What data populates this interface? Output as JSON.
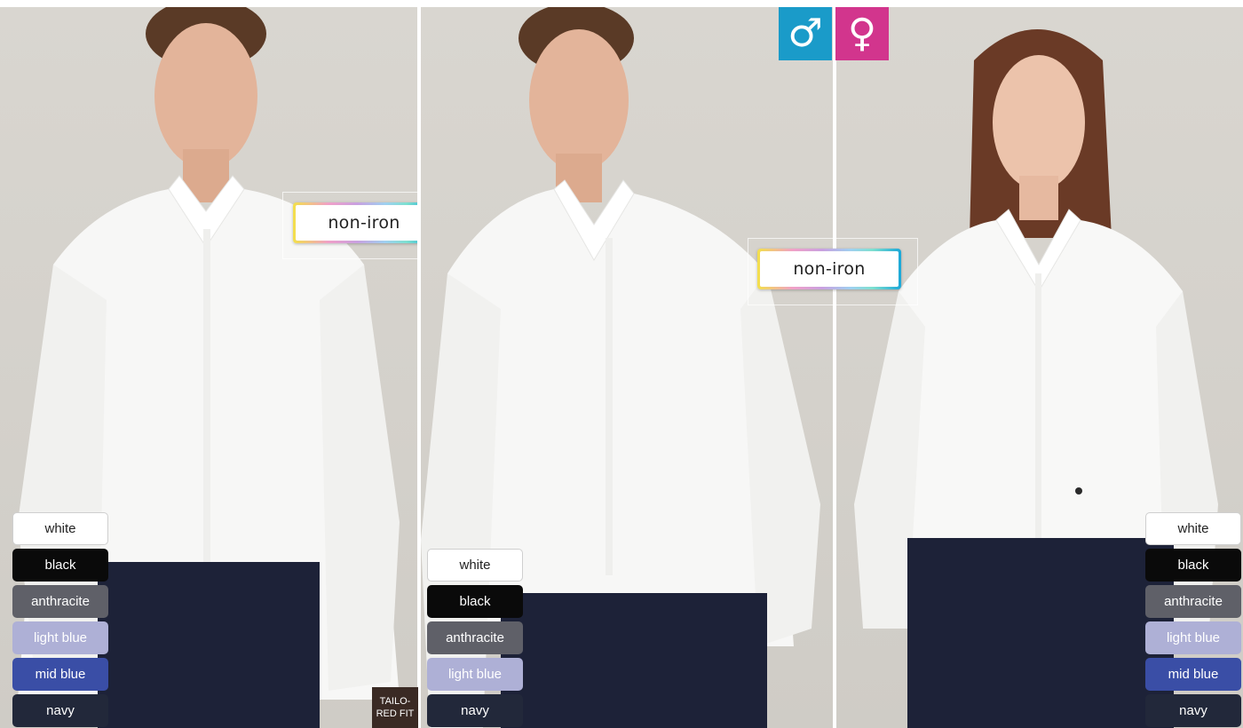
{
  "badges": {
    "non_iron_1": "non-iron",
    "non_iron_2": "non-iron"
  },
  "gender_icons": {
    "male": {
      "icon": "male-symbol-icon",
      "glyph": "♂",
      "color": "#1a9bc9"
    },
    "female": {
      "icon": "female-symbol-icon",
      "glyph": "♀",
      "color": "#d2358d"
    }
  },
  "tailored_fit_label": "TAILO-\nRED FIT",
  "swatches_left": [
    {
      "label": "white",
      "bg": "#ffffff",
      "fg": "#222222"
    },
    {
      "label": "black",
      "bg": "#0a0a0a",
      "fg": "#ffffff"
    },
    {
      "label": "anthracite",
      "bg": "#5f6068",
      "fg": "#ffffff"
    },
    {
      "label": "light blue",
      "bg": "#aeb0d6",
      "fg": "#ffffff"
    },
    {
      "label": "mid blue",
      "bg": "#3a4ea6",
      "fg": "#ffffff"
    },
    {
      "label": "navy",
      "bg": "#22283a",
      "fg": "#ffffff"
    }
  ],
  "swatches_middle": [
    {
      "label": "white",
      "bg": "#ffffff",
      "fg": "#222222"
    },
    {
      "label": "black",
      "bg": "#0a0a0a",
      "fg": "#ffffff"
    },
    {
      "label": "anthracite",
      "bg": "#5f6068",
      "fg": "#ffffff"
    },
    {
      "label": "light blue",
      "bg": "#aeb0d6",
      "fg": "#ffffff"
    },
    {
      "label": "navy",
      "bg": "#22283a",
      "fg": "#ffffff"
    }
  ],
  "swatches_right": [
    {
      "label": "white",
      "bg": "#ffffff",
      "fg": "#222222"
    },
    {
      "label": "black",
      "bg": "#0a0a0a",
      "fg": "#ffffff"
    },
    {
      "label": "anthracite",
      "bg": "#5f6068",
      "fg": "#ffffff"
    },
    {
      "label": "light blue",
      "bg": "#aeb0d6",
      "fg": "#ffffff"
    },
    {
      "label": "mid blue",
      "bg": "#3a4ea6",
      "fg": "#ffffff"
    },
    {
      "label": "navy",
      "bg": "#22283a",
      "fg": "#ffffff"
    }
  ]
}
